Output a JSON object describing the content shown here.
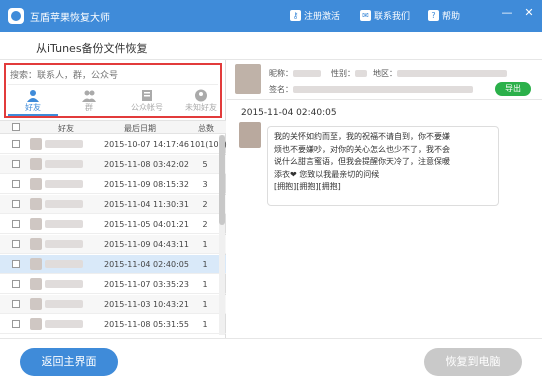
{
  "titlebar": {
    "app_title": "互盾苹果恢复大师",
    "register": "注册激活",
    "contact": "联系我们",
    "help": "帮助",
    "min": "—",
    "close": "✕"
  },
  "subheader": {
    "title": "从iTunes备份文件恢复"
  },
  "search": {
    "placeholder": "搜索：联系人，群，公众号"
  },
  "tabs": [
    {
      "label": "好友",
      "icon": "person-icon"
    },
    {
      "label": "群",
      "icon": "group-icon"
    },
    {
      "label": "公众帐号",
      "icon": "official-account-icon"
    },
    {
      "label": "未知好友",
      "icon": "unknown-friend-icon"
    }
  ],
  "table": {
    "headers": {
      "friend": "好友",
      "last_date": "最后日期",
      "total": "总数"
    },
    "rows": [
      {
        "date": "2015-10-07 14:17:46",
        "total": "101(101)"
      },
      {
        "date": "2015-11-08 03:42:02",
        "total": "5"
      },
      {
        "date": "2015-11-09 08:15:32",
        "total": "3"
      },
      {
        "date": "2015-11-04 11:30:31",
        "total": "2"
      },
      {
        "date": "2015-11-05 04:01:21",
        "total": "2"
      },
      {
        "date": "2015-11-09 04:43:11",
        "total": "1"
      },
      {
        "date": "2015-11-04 02:40:05",
        "total": "1"
      },
      {
        "date": "2015-11-07 03:35:23",
        "total": "1"
      },
      {
        "date": "2015-11-03 10:43:21",
        "total": "1"
      },
      {
        "date": "2015-11-08 05:31:55",
        "total": "1"
      }
    ]
  },
  "contact": {
    "nickname_label": "昵称：",
    "gender_label": "性别：",
    "region_label": "地区：",
    "signature_label": "签名：",
    "export": "导出"
  },
  "message": {
    "time": "2015-11-04 02:40:05",
    "lines": [
      "我的关怀如约而至，我的祝福不请自到，你不要嫌",
      "烦也不要嫌吵，对你的关心怎么也少不了，我不会",
      "说什么甜言蜜语，但我会提醒你天冷了，注意保暖",
      "添衣❤                        您致以我最亲切的问候",
      "[拥抱][拥抱][拥抱]"
    ]
  },
  "bottom": {
    "back": "返回主界面",
    "restore": "恢复到电脑"
  },
  "colors": {
    "accent": "#3f8bd9",
    "highlight": "#e23b3b",
    "export": "#2bb04a",
    "disabled": "#c9c9c9"
  }
}
